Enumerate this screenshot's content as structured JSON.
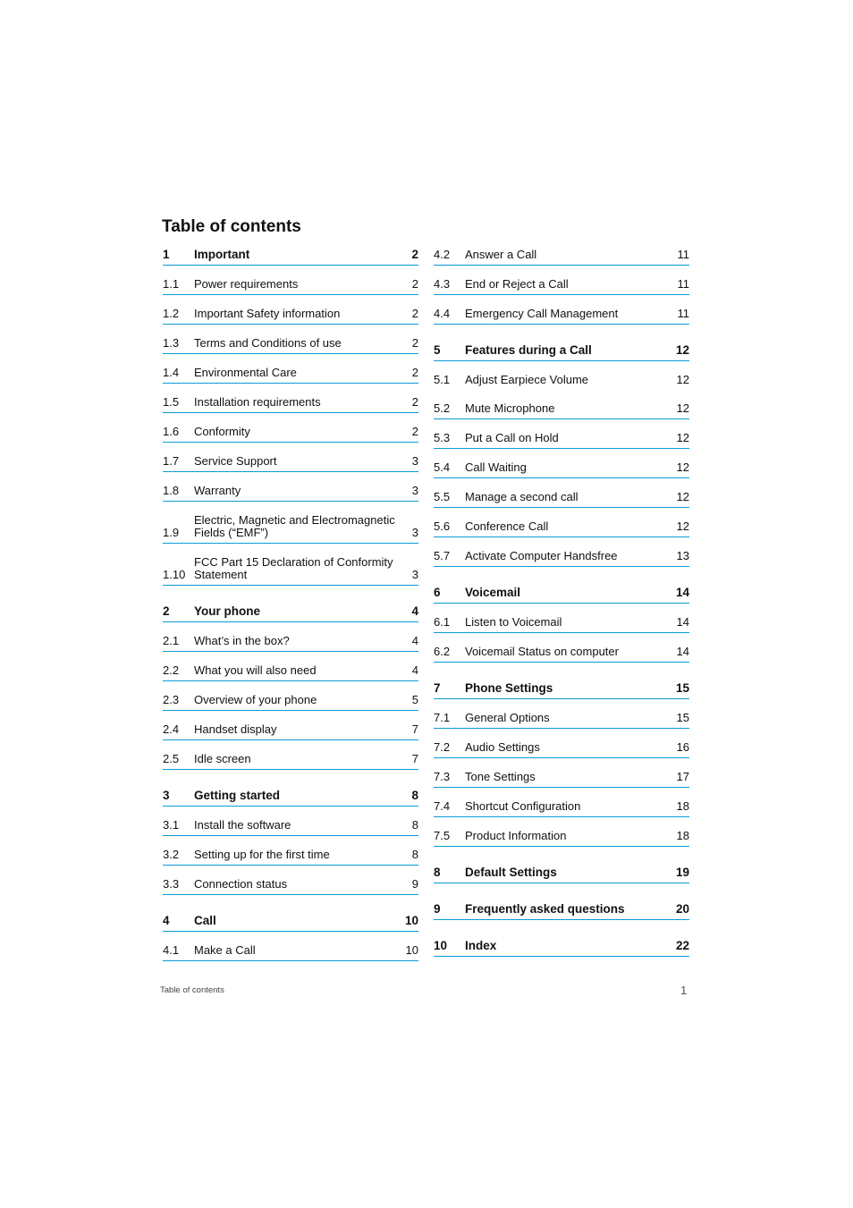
{
  "title": "Table of contents",
  "accent_color": "#0b9ad6",
  "left_column": [
    {
      "num": "1",
      "label": "Important",
      "page": "2",
      "chapter": true,
      "line": true,
      "gap": 0
    },
    {
      "num": "1.1",
      "label": "Power requirements",
      "page": "2",
      "line": true,
      "gap": 14
    },
    {
      "num": "1.2",
      "label": "Important Safety information",
      "page": "2",
      "line": true,
      "gap": 14
    },
    {
      "num": "1.3",
      "label": "Terms and Conditions of use",
      "page": "2",
      "line": true,
      "gap": 14
    },
    {
      "num": "1.4",
      "label": "Environmental Care",
      "page": "2",
      "line": true,
      "gap": 14
    },
    {
      "num": "1.5",
      "label": "Installation requirements",
      "page": "2",
      "line": true,
      "gap": 14
    },
    {
      "num": "1.6",
      "label": "Conformity",
      "page": "2",
      "line": true,
      "gap": 14
    },
    {
      "num": "1.7",
      "label": "Service Support",
      "page": "3",
      "line": true,
      "gap": 14
    },
    {
      "num": "1.8",
      "label": "Warranty",
      "page": "3",
      "line": true,
      "gap": 14
    },
    {
      "num": "1.9",
      "label": "Electric, Magnetic and Electromagnetic Fields (“EMF”)",
      "page": "3",
      "line": true,
      "gap": 14
    },
    {
      "num": "1.10",
      "label": "FCC Part 15 Declaration of Conformity Statement",
      "page": "3",
      "line": true,
      "gap": 14
    },
    {
      "num": "2",
      "label": "Your phone",
      "page": "4",
      "chapter": true,
      "line": true,
      "gap": 24
    },
    {
      "num": "2.1",
      "label": "What’s in the box?",
      "page": "4",
      "line": true,
      "gap": 14
    },
    {
      "num": "2.2",
      "label": "What you will also need",
      "page": "4",
      "line": true,
      "gap": 14
    },
    {
      "num": "2.3",
      "label": "Overview of your phone",
      "page": "5",
      "line": true,
      "gap": 14
    },
    {
      "num": "2.4",
      "label": "Handset display",
      "page": "7",
      "line": true,
      "gap": 14
    },
    {
      "num": "2.5",
      "label": "Idle screen",
      "page": "7",
      "line": true,
      "gap": 14
    },
    {
      "num": "3",
      "label": "Getting started",
      "page": "8",
      "chapter": true,
      "line": true,
      "gap": 24
    },
    {
      "num": "3.1",
      "label": "Install the software",
      "page": "8",
      "line": true,
      "gap": 14
    },
    {
      "num": "3.2",
      "label": "Setting up for the first time",
      "page": "8",
      "line": true,
      "gap": 14
    },
    {
      "num": "3.3",
      "label": "Connection status",
      "page": "9",
      "line": true,
      "gap": 14
    },
    {
      "num": "4",
      "label": "Call",
      "page": "10",
      "chapter": true,
      "line": true,
      "gap": 24
    },
    {
      "num": "4.1",
      "label": "Make a Call",
      "page": "10",
      "line": true,
      "gap": 14
    }
  ],
  "right_column": [
    {
      "num": "4.2",
      "label": "Answer a Call",
      "page": "11",
      "line": true,
      "gap": 0
    },
    {
      "num": "4.3",
      "label": "End or Reject a Call",
      "page": "11",
      "line": true,
      "gap": 14
    },
    {
      "num": "4.4",
      "label": "Emergency Call Management",
      "page": "11",
      "line": true,
      "gap": 14
    },
    {
      "num": "5",
      "label": "Features during a Call",
      "page": "12",
      "chapter": true,
      "line": true,
      "gap": 24
    },
    {
      "num": "5.1",
      "label": "Adjust Earpiece Volume",
      "page": "12",
      "line": false,
      "gap": 14
    },
    {
      "num": "5.2",
      "label": "Mute Microphone",
      "page": "12",
      "line": true,
      "gap": 15
    },
    {
      "num": "5.3",
      "label": "Put a Call on Hold",
      "page": "12",
      "line": true,
      "gap": 14
    },
    {
      "num": "5.4",
      "label": "Call Waiting",
      "page": "12",
      "line": true,
      "gap": 14
    },
    {
      "num": "5.5",
      "label": "Manage a second call",
      "page": "12",
      "line": true,
      "gap": 14
    },
    {
      "num": "5.6",
      "label": "Conference Call",
      "page": "12",
      "line": true,
      "gap": 14
    },
    {
      "num": "5.7",
      "label": "Activate Computer Handsfree",
      "page": "13",
      "line": true,
      "gap": 14
    },
    {
      "num": "6",
      "label": "Voicemail",
      "page": "14",
      "chapter": true,
      "line": true,
      "gap": 24
    },
    {
      "num": "6.1",
      "label": "Listen to Voicemail",
      "page": "14",
      "line": true,
      "gap": 14
    },
    {
      "num": "6.2",
      "label": "Voicemail Status on computer",
      "page": "14",
      "line": true,
      "gap": 14
    },
    {
      "num": "7",
      "label": "Phone Settings",
      "page": "15",
      "chapter": true,
      "line": true,
      "gap": 24
    },
    {
      "num": "7.1",
      "label": "General Options",
      "page": "15",
      "line": true,
      "gap": 14
    },
    {
      "num": "7.2",
      "label": "Audio Settings",
      "page": "16",
      "line": true,
      "gap": 14
    },
    {
      "num": "7.3",
      "label": "Tone Settings",
      "page": "17",
      "line": true,
      "gap": 14
    },
    {
      "num": "7.4",
      "label": "Shortcut Configuration",
      "page": "18",
      "line": true,
      "gap": 14
    },
    {
      "num": "7.5",
      "label": "Product Information",
      "page": "18",
      "line": true,
      "gap": 14
    },
    {
      "num": "8",
      "label": "Default Settings",
      "page": "19",
      "chapter": true,
      "line": true,
      "gap": 24
    },
    {
      "num": "9",
      "label": "Frequently asked questions",
      "page": "20",
      "chapter": true,
      "line": true,
      "gap": 24
    },
    {
      "num": "10",
      "label": "Index",
      "page": "22",
      "chapter": true,
      "line": true,
      "gap": 24
    }
  ],
  "footer": {
    "section": "Table of contents",
    "page_number": "1"
  }
}
